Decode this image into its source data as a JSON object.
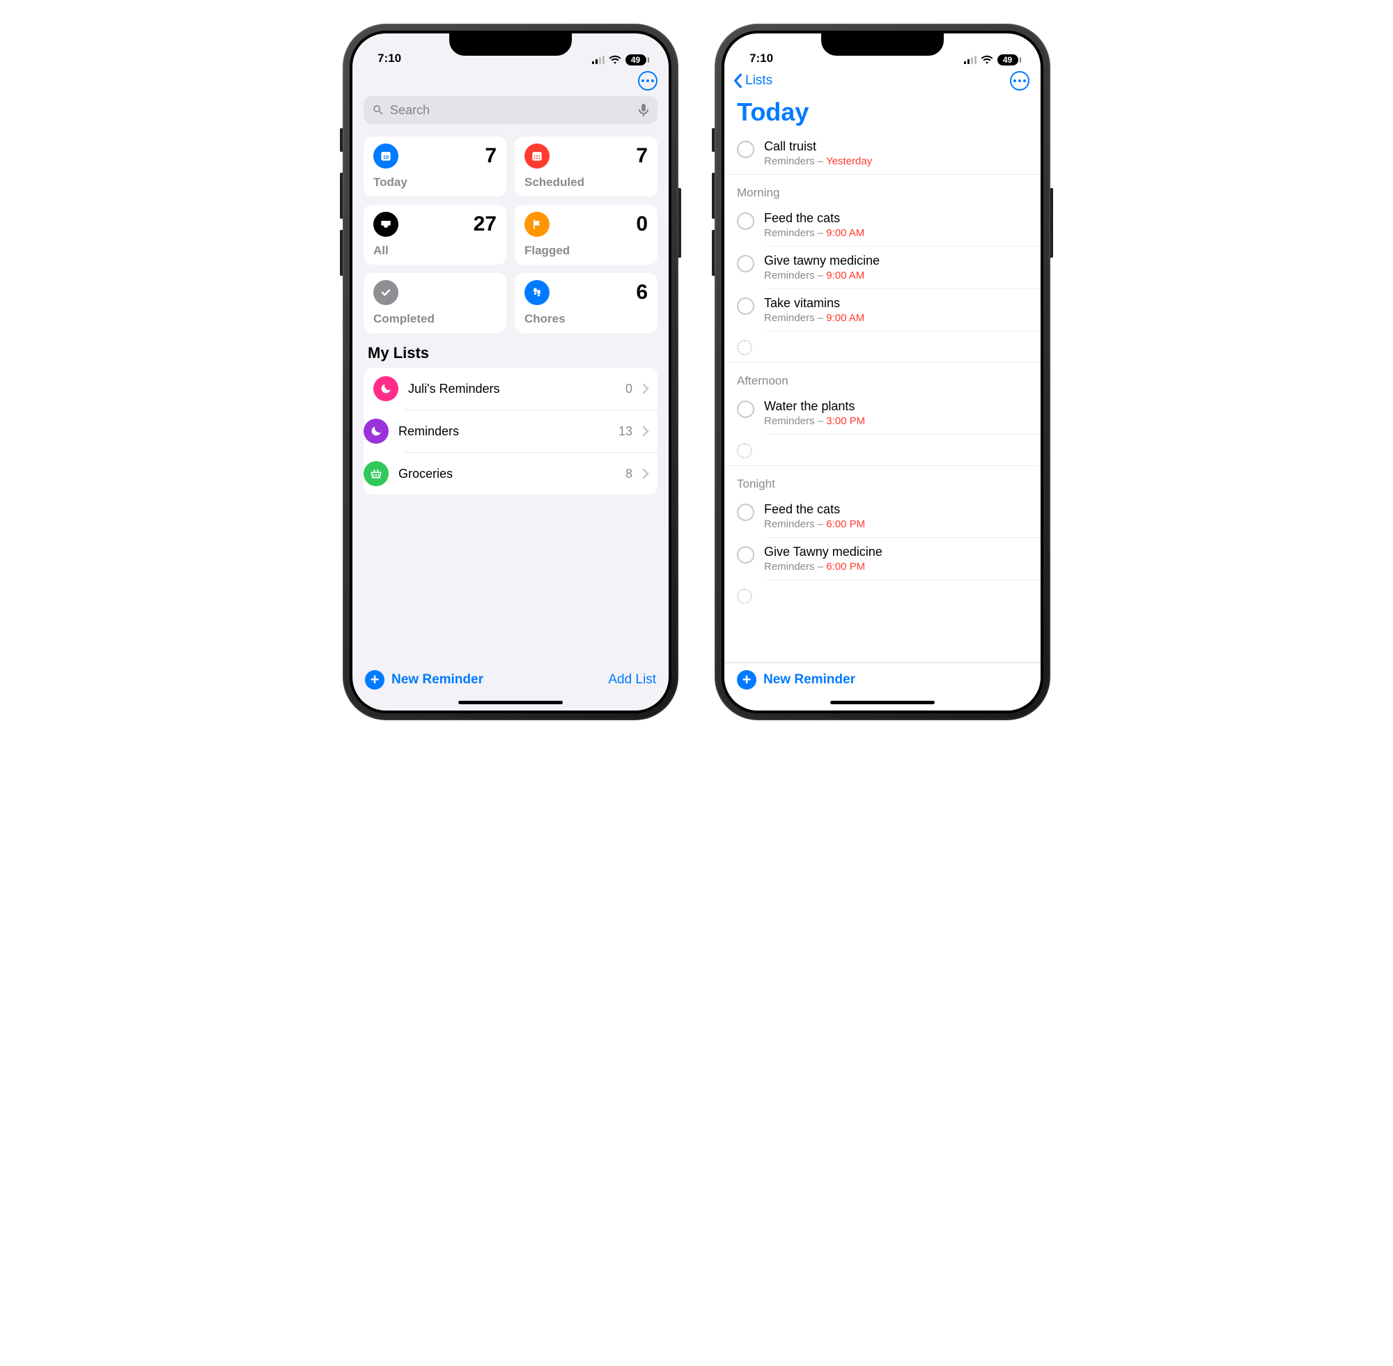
{
  "status": {
    "time": "7:10",
    "battery": "49"
  },
  "screenA": {
    "search": {
      "placeholder": "Search"
    },
    "smart": {
      "today": {
        "label": "Today",
        "count": "7",
        "color": "#007aff"
      },
      "scheduled": {
        "label": "Scheduled",
        "count": "7",
        "color": "#ff3b30"
      },
      "all": {
        "label": "All",
        "count": "27",
        "color": "#000000"
      },
      "flagged": {
        "label": "Flagged",
        "count": "0",
        "color": "#ff9500"
      },
      "completed": {
        "label": "Completed",
        "count": "",
        "color": "#8e8e93"
      },
      "chores": {
        "label": "Chores",
        "count": "6",
        "color": "#007aff"
      }
    },
    "mylists_title": "My Lists",
    "lists": [
      {
        "name": "Juli's Reminders",
        "count": "0",
        "color": "#ff2d88"
      },
      {
        "name": "Reminders",
        "count": "13",
        "color": "#9a34da"
      },
      {
        "name": "Groceries",
        "count": "8",
        "color": "#30c85b"
      }
    ],
    "new_reminder": "New Reminder",
    "add_list": "Add List"
  },
  "screenB": {
    "back_label": "Lists",
    "title": "Today",
    "top_item": {
      "title": "Call truist",
      "source": "Reminders",
      "due": "Yesterday"
    },
    "sections": [
      {
        "header": "Morning",
        "items": [
          {
            "title": "Feed the cats",
            "source": "Reminders",
            "due": "9:00 AM"
          },
          {
            "title": "Give tawny medicine",
            "source": "Reminders",
            "due": "9:00 AM"
          },
          {
            "title": "Take vitamins",
            "source": "Reminders",
            "due": "9:00 AM"
          }
        ]
      },
      {
        "header": "Afternoon",
        "items": [
          {
            "title": "Water the plants",
            "source": "Reminders",
            "due": "3:00 PM"
          }
        ]
      },
      {
        "header": "Tonight",
        "items": [
          {
            "title": "Feed the cats",
            "source": "Reminders",
            "due": "6:00 PM"
          },
          {
            "title": "Give Tawny medicine",
            "source": "Reminders",
            "due": "6:00 PM"
          }
        ]
      }
    ],
    "new_reminder": "New Reminder"
  }
}
